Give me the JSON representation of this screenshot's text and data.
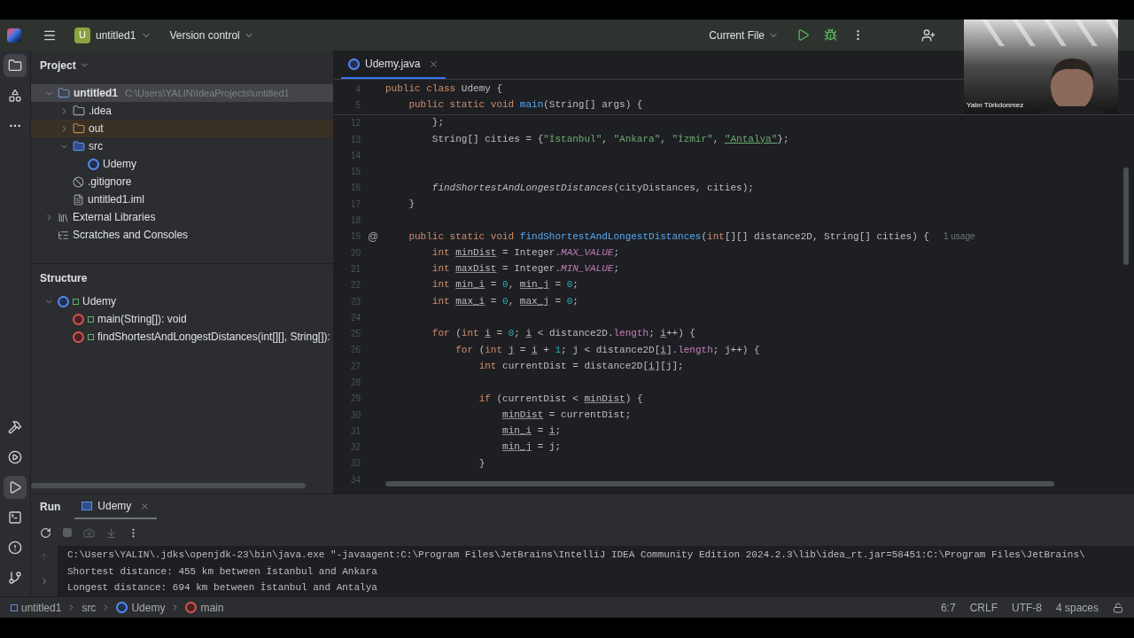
{
  "titlebar": {
    "project_badge": "U",
    "project": "untitled1",
    "vcs": "Version control",
    "run_config": "Current File"
  },
  "tool_stripe": {
    "top": [
      {
        "kind": "project",
        "selected": true
      },
      {
        "kind": "structure",
        "selected": false
      },
      {
        "kind": "more",
        "selected": false
      }
    ],
    "bottom": [
      {
        "kind": "build",
        "selected": false
      },
      {
        "kind": "services",
        "selected": false
      },
      {
        "kind": "run",
        "selected": true
      },
      {
        "kind": "terminal",
        "selected": false
      },
      {
        "kind": "problems",
        "selected": false
      },
      {
        "kind": "git",
        "selected": false
      }
    ]
  },
  "project_panel": {
    "title": "Project",
    "tree": [
      {
        "kind": "module",
        "label": "untitled1",
        "path": "C:\\Users\\YALIN\\IdeaProjects\\untitled1",
        "expanded": true,
        "selected": true,
        "children": [
          {
            "kind": "folder",
            "label": ".idea",
            "expanded": false,
            "selected": false
          },
          {
            "kind": "excluded_folder",
            "label": "out",
            "expanded": false,
            "selected": false
          },
          {
            "kind": "source_folder",
            "label": "src",
            "expanded": true,
            "selected": false,
            "children": [
              {
                "kind": "class",
                "label": "Udemy",
                "selected": false
              }
            ]
          },
          {
            "kind": "ignore_file",
            "label": ".gitignore",
            "selected": false
          },
          {
            "kind": "module_file",
            "label": "untitled1.iml",
            "selected": false
          }
        ]
      },
      {
        "kind": "library",
        "label": "External Libraries",
        "expanded": false,
        "selected": false
      },
      {
        "kind": "scratches",
        "label": "Scratches and Consoles",
        "selected": false
      }
    ]
  },
  "structure_panel": {
    "title": "Structure",
    "tree": [
      {
        "kind": "class",
        "label": "Udemy",
        "expanded": true,
        "children": [
          {
            "kind": "method",
            "label": "main(String[]): void"
          },
          {
            "kind": "method",
            "label": "findShortestAndLongestDistances(int[][], String[]):"
          }
        ]
      }
    ]
  },
  "editor": {
    "tabs": [
      {
        "label": "Udemy.java",
        "selected": true
      }
    ],
    "sticky_lines": [
      {
        "n": "4",
        "tokens": [
          {
            "text": "public class ",
            "kind": "kw"
          },
          {
            "text": "Udemy {",
            "kind": "plain"
          }
        ]
      },
      {
        "n": "5",
        "tokens": [
          {
            "text": "    public static void ",
            "kind": "kw"
          },
          {
            "text": "main",
            "kind": "fn"
          },
          {
            "text": "(String[] args) {",
            "kind": "plain"
          }
        ]
      }
    ],
    "lines": [
      {
        "n": "12",
        "tokens": [
          {
            "text": "        };",
            "kind": "plain"
          }
        ]
      },
      {
        "n": "13",
        "tokens": [
          {
            "text": "        String[] cities = {",
            "kind": "plain"
          },
          {
            "text": "\"İstanbul\"",
            "kind": "str"
          },
          {
            "text": ", ",
            "kind": "plain"
          },
          {
            "text": "\"Ankara\"",
            "kind": "str"
          },
          {
            "text": ", ",
            "kind": "plain"
          },
          {
            "text": "\"İzmir\"",
            "kind": "str"
          },
          {
            "text": ", ",
            "kind": "plain"
          },
          {
            "text": "\"Antalya\"",
            "kind": "str_warn"
          },
          {
            "text": "};",
            "kind": "plain"
          }
        ]
      },
      {
        "n": "14"
      },
      {
        "n": "15"
      },
      {
        "n": "16",
        "tokens": [
          {
            "text": "        findShortestAndLongestDistances",
            "kind": "call"
          },
          {
            "text": "(cityDistances, cities);",
            "kind": "plain"
          }
        ]
      },
      {
        "n": "17",
        "tokens": [
          {
            "text": "    }",
            "kind": "plain"
          }
        ]
      },
      {
        "n": "18"
      },
      {
        "n": "19",
        "gutter_mark": "@",
        "hint": "1 usage",
        "tokens": [
          {
            "text": "    public static void ",
            "kind": "kw"
          },
          {
            "text": "findShortestAndLongestDistances",
            "kind": "fn"
          },
          {
            "text": "(",
            "kind": "plain"
          },
          {
            "text": "int",
            "kind": "kw"
          },
          {
            "text": "[][] distance2D, String[] cities) {",
            "kind": "plain"
          }
        ]
      },
      {
        "n": "20",
        "tokens": [
          {
            "text": "        int ",
            "kind": "kw"
          },
          {
            "text": "minDist",
            "kind": "var"
          },
          {
            "text": " = Integer.",
            "kind": "plain"
          },
          {
            "text": "MAX_VALUE",
            "kind": "const"
          },
          {
            "text": ";",
            "kind": "plain"
          }
        ]
      },
      {
        "n": "21",
        "tokens": [
          {
            "text": "        int ",
            "kind": "kw"
          },
          {
            "text": "maxDist",
            "kind": "var"
          },
          {
            "text": " = Integer.",
            "kind": "plain"
          },
          {
            "text": "MIN_VALUE",
            "kind": "const"
          },
          {
            "text": ";",
            "kind": "plain"
          }
        ]
      },
      {
        "n": "22",
        "tokens": [
          {
            "text": "        int ",
            "kind": "kw"
          },
          {
            "text": "min_i",
            "kind": "var"
          },
          {
            "text": " = ",
            "kind": "plain"
          },
          {
            "text": "0",
            "kind": "num"
          },
          {
            "text": ", ",
            "kind": "plain"
          },
          {
            "text": "min_j",
            "kind": "var"
          },
          {
            "text": " = ",
            "kind": "plain"
          },
          {
            "text": "0",
            "kind": "num"
          },
          {
            "text": ";",
            "kind": "plain"
          }
        ]
      },
      {
        "n": "23",
        "tokens": [
          {
            "text": "        int ",
            "kind": "kw"
          },
          {
            "text": "max_i",
            "kind": "var"
          },
          {
            "text": " = ",
            "kind": "plain"
          },
          {
            "text": "0",
            "kind": "num"
          },
          {
            "text": ", ",
            "kind": "plain"
          },
          {
            "text": "max_j",
            "kind": "var"
          },
          {
            "text": " = ",
            "kind": "plain"
          },
          {
            "text": "0",
            "kind": "num"
          },
          {
            "text": ";",
            "kind": "plain"
          }
        ]
      },
      {
        "n": "24"
      },
      {
        "n": "25",
        "tokens": [
          {
            "text": "        for ",
            "kind": "kw"
          },
          {
            "text": "(",
            "kind": "plain"
          },
          {
            "text": "int ",
            "kind": "kw"
          },
          {
            "text": "i",
            "kind": "var"
          },
          {
            "text": " = ",
            "kind": "plain"
          },
          {
            "text": "0",
            "kind": "num"
          },
          {
            "text": "; ",
            "kind": "plain"
          },
          {
            "text": "i",
            "kind": "var"
          },
          {
            "text": " < distance2D.",
            "kind": "plain"
          },
          {
            "text": "length",
            "kind": "field"
          },
          {
            "text": "; ",
            "kind": "plain"
          },
          {
            "text": "i",
            "kind": "var"
          },
          {
            "text": "++) {",
            "kind": "plain"
          }
        ]
      },
      {
        "n": "26",
        "tokens": [
          {
            "text": "            for ",
            "kind": "kw"
          },
          {
            "text": "(",
            "kind": "plain"
          },
          {
            "text": "int ",
            "kind": "kw"
          },
          {
            "text": "j",
            "kind": "var"
          },
          {
            "text": " = ",
            "kind": "plain"
          },
          {
            "text": "i",
            "kind": "var"
          },
          {
            "text": " + ",
            "kind": "plain"
          },
          {
            "text": "1",
            "kind": "num"
          },
          {
            "text": "; j < distance2D[",
            "kind": "plain"
          },
          {
            "text": "i",
            "kind": "var"
          },
          {
            "text": "].",
            "kind": "plain"
          },
          {
            "text": "length",
            "kind": "field"
          },
          {
            "text": "; j++) {",
            "kind": "plain"
          }
        ]
      },
      {
        "n": "27",
        "tokens": [
          {
            "text": "                int ",
            "kind": "kw"
          },
          {
            "text": "currentDist = distance2D[",
            "kind": "plain"
          },
          {
            "text": "i",
            "kind": "var"
          },
          {
            "text": "][j];",
            "kind": "plain"
          }
        ]
      },
      {
        "n": "28"
      },
      {
        "n": "29",
        "tokens": [
          {
            "text": "                if ",
            "kind": "kw"
          },
          {
            "text": "(currentDist < ",
            "kind": "plain"
          },
          {
            "text": "minDist",
            "kind": "var"
          },
          {
            "text": ") {",
            "kind": "plain"
          }
        ]
      },
      {
        "n": "30",
        "tokens": [
          {
            "text": "                    minDist",
            "kind": "var"
          },
          {
            "text": " = currentDist;",
            "kind": "plain"
          }
        ]
      },
      {
        "n": "31",
        "tokens": [
          {
            "text": "                    min_i",
            "kind": "var"
          },
          {
            "text": " = ",
            "kind": "plain"
          },
          {
            "text": "i",
            "kind": "var"
          },
          {
            "text": ";",
            "kind": "plain"
          }
        ]
      },
      {
        "n": "32",
        "tokens": [
          {
            "text": "                    min_j",
            "kind": "var"
          },
          {
            "text": " = j;",
            "kind": "plain"
          }
        ]
      },
      {
        "n": "33",
        "tokens": [
          {
            "text": "                }",
            "kind": "plain"
          }
        ]
      },
      {
        "n": "34"
      }
    ]
  },
  "run_panel": {
    "title": "Run",
    "tabs": [
      {
        "label": "Udemy",
        "selected": true
      }
    ],
    "output": [
      "C:\\Users\\YALIN\\.jdks\\openjdk-23\\bin\\java.exe \"-javaagent:C:\\Program Files\\JetBrains\\IntelliJ IDEA Community Edition 2024.2.3\\lib\\idea_rt.jar=58451:C:\\Program Files\\JetBrains\\",
      "Shortest distance: 455 km between İstanbul and Ankara",
      "Longest distance: 694 km between İstanbul and Antalya"
    ]
  },
  "status_bar": {
    "breadcrumbs": [
      {
        "kind": "module",
        "label": "untitled1"
      },
      {
        "kind": "folder",
        "label": "src"
      },
      {
        "kind": "class",
        "label": "Udemy"
      },
      {
        "kind": "method",
        "label": "main"
      }
    ],
    "items": [
      "6:7",
      "CRLF",
      "UTF-8",
      "4 spaces"
    ]
  },
  "video_call": {
    "participant": "Yalın Türkdonmez"
  }
}
